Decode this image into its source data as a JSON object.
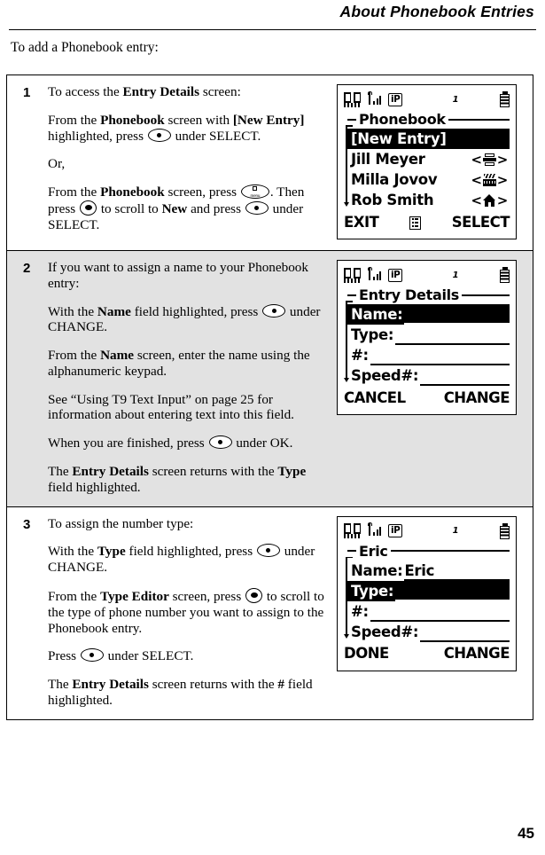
{
  "header": {
    "title": "About Phonebook Entries"
  },
  "intro": "To add a Phonebook entry:",
  "folio": "45",
  "steps": [
    {
      "number": "1",
      "shaded": false,
      "paragraphs": [
        {
          "id": "p1",
          "text_runs": "To access the Entry Details screen:"
        },
        {
          "id": "p2",
          "text_runs": "From the Phonebook screen with [New Entry] highlighted, press (select) under SELECT."
        },
        {
          "id": "p3",
          "text_runs": "Or,"
        },
        {
          "id": "p4",
          "text_runs": "From the Phonebook screen, press (menu). Then press (nav) to scroll to New and press (select) under SELECT."
        }
      ],
      "fragments": {
        "p1_a": "To access the ",
        "p1_b": "Entry Details",
        "p1_c": " screen:",
        "p2_a": "From the ",
        "p2_b": "Phonebook",
        "p2_c": " screen with ",
        "p2_d": "[New Entry]",
        "p2_e": " highlighted, press ",
        "p2_f": " under SELECT.",
        "p3_a": "Or,",
        "p4_a": "From the ",
        "p4_b": "Phonebook",
        "p4_c": " screen, press ",
        "p4_d": ". Then press ",
        "p4_e": " to scroll to ",
        "p4_f": "New",
        "p4_g": " and press ",
        "p4_h": " under SELECT."
      }
    },
    {
      "number": "2",
      "shaded": true,
      "fragments": {
        "p1_a": "If you want to assign a name to your Phonebook entry:",
        "p2_a": "With the ",
        "p2_b": "Name",
        "p2_c": " field highlighted, press ",
        "p2_d": " under CHANGE.",
        "p3_a": "From the ",
        "p3_b": "Name",
        "p3_c": " screen, enter the name using the alphanumeric keypad.",
        "p4_a": "See “Using T9 Text Input” on page 25 for information about entering text into this field.",
        "p5_a": "When you are finished, press ",
        "p5_b": " under OK.",
        "p6_a": "The ",
        "p6_b": "Entry Details",
        "p6_c": " screen returns with the ",
        "p6_d": "Type",
        "p6_e": " field highlighted."
      }
    },
    {
      "number": "3",
      "shaded": false,
      "fragments": {
        "p1_a": "To assign the number type:",
        "p2_a": "With the ",
        "p2_b": "Type",
        "p2_c": " field highlighted, press ",
        "p2_d": " under CHANGE.",
        "p3_a": "From the ",
        "p3_b": "Type Editor",
        "p3_c": " screen, press ",
        "p3_d": " to scroll to the type of phone number you want to assign to the Phonebook entry.",
        "p4_a": "Press ",
        "p4_b": " under SELECT.",
        "p5_a": "The ",
        "p5_b": "Entry Details",
        "p5_c": " screen returns with the ",
        "p5_d": "#",
        "p5_e": " field highlighted."
      }
    }
  ],
  "screens": {
    "status_bar": {
      "ip_label": "iP",
      "line_number": "1",
      "icons": [
        "phonebook-book-icon",
        "signal-antenna-icon",
        "ip-mode-icon",
        "battery-icon"
      ]
    },
    "phonebook": {
      "title": "Phonebook",
      "rows": [
        {
          "label": "[New Entry]",
          "tag": "",
          "tag_icon": "",
          "highlighted": true
        },
        {
          "label": "Jill Meyer",
          "tag": "<>",
          "tag_icon": "fax-icon",
          "highlighted": false
        },
        {
          "label": "Milla Jovov",
          "tag": "<>",
          "tag_icon": "office-icon",
          "highlighted": false
        },
        {
          "label": "Rob Smith",
          "tag": "<>",
          "tag_icon": "home-icon",
          "highlighted": false
        }
      ],
      "softkey_left": "EXIT",
      "softkey_center_icon": "menu-icon",
      "softkey_right": "SELECT"
    },
    "entry_details_empty": {
      "title": "Entry Details",
      "fields": [
        {
          "name": "Name:",
          "value": "",
          "highlighted": true
        },
        {
          "name": "Type:",
          "value": "",
          "highlighted": false
        },
        {
          "name": "#:",
          "value": "",
          "highlighted": false
        },
        {
          "name": "Speed#:",
          "value": "",
          "highlighted": false
        }
      ],
      "softkey_left": "CANCEL",
      "softkey_right": "CHANGE"
    },
    "entry_details_eric": {
      "title": "Eric",
      "fields": [
        {
          "name": "Name:",
          "value": "Eric",
          "highlighted": false
        },
        {
          "name": "Type:",
          "value": "",
          "highlighted": true
        },
        {
          "name": "#:",
          "value": "",
          "highlighted": false
        },
        {
          "name": "Speed#:",
          "value": "",
          "highlighted": false
        }
      ],
      "softkey_left": "DONE",
      "softkey_right": "CHANGE"
    }
  }
}
